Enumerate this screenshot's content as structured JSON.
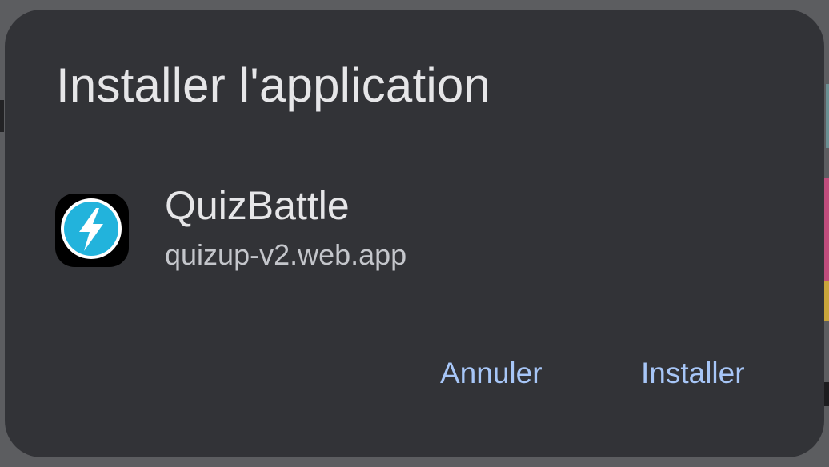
{
  "dialog": {
    "title": "Installer l'application",
    "app": {
      "name": "QuizBattle",
      "url": "quizup-v2.web.app",
      "icon": "lightning-bolt-icon"
    },
    "buttons": {
      "cancel_label": "Annuler",
      "install_label": "Installer"
    }
  },
  "colors": {
    "dialog_background": "#323337",
    "title_text": "#e6e6e8",
    "secondary_text": "#c4c6cb",
    "accent": "#a7c6f7",
    "icon_circle": "#22b3dc",
    "scrim": "#5c5d60"
  }
}
